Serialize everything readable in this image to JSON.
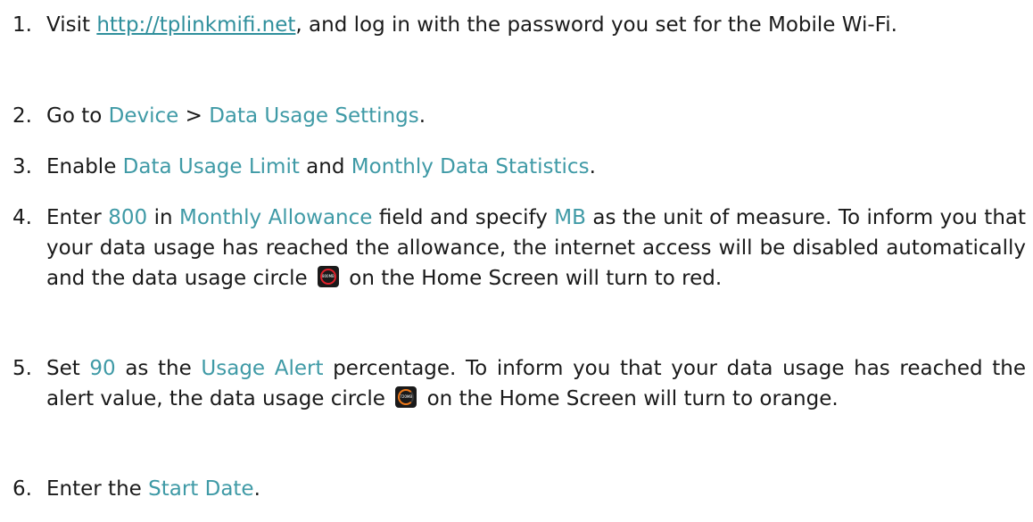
{
  "steps": [
    {
      "num": "1.",
      "t1": "Visit ",
      "link": "http://tplinkmifi.net",
      "t2": ", and log in with the password you set for the Mobile Wi-Fi."
    },
    {
      "num": "2.",
      "t1": "Go to ",
      "h1": "Device",
      "t2": " > ",
      "h2": "Data Usage Settings",
      "t3": "."
    },
    {
      "num": "3.",
      "t1": "Enable ",
      "h1": "Data Usage Limit",
      "t2": " and ",
      "h2": "Monthly Data Statistics",
      "t3": "."
    },
    {
      "num": "4.",
      "t1": "Enter ",
      "h1": "800",
      "t2": " in ",
      "h2": "Monthly Allowance",
      "t3": " field and specify ",
      "h3": "MB",
      "t4": " as the unit of measure. To inform you that your data usage has reached the allowance, the internet access will be disabled automatically and the data usage circle",
      "t5": "on the Home Screen  will turn to red.",
      "icon_text": "800MB",
      "icon_color": "#e0202a"
    },
    {
      "num": "5.",
      "t1": "Set ",
      "h1": "90",
      "t2": " as the ",
      "h2": "Usage Alert",
      "t3": " percentage. To inform you that your data usage has reached the alert value, the data usage circle",
      "t4": "on the Home Screen will turn to orange.",
      "icon_text": "720MB",
      "icon_color": "#f07a1a"
    },
    {
      "num": "6.",
      "t1": "Enter the ",
      "h1": "Start Date",
      "t2": "."
    }
  ]
}
